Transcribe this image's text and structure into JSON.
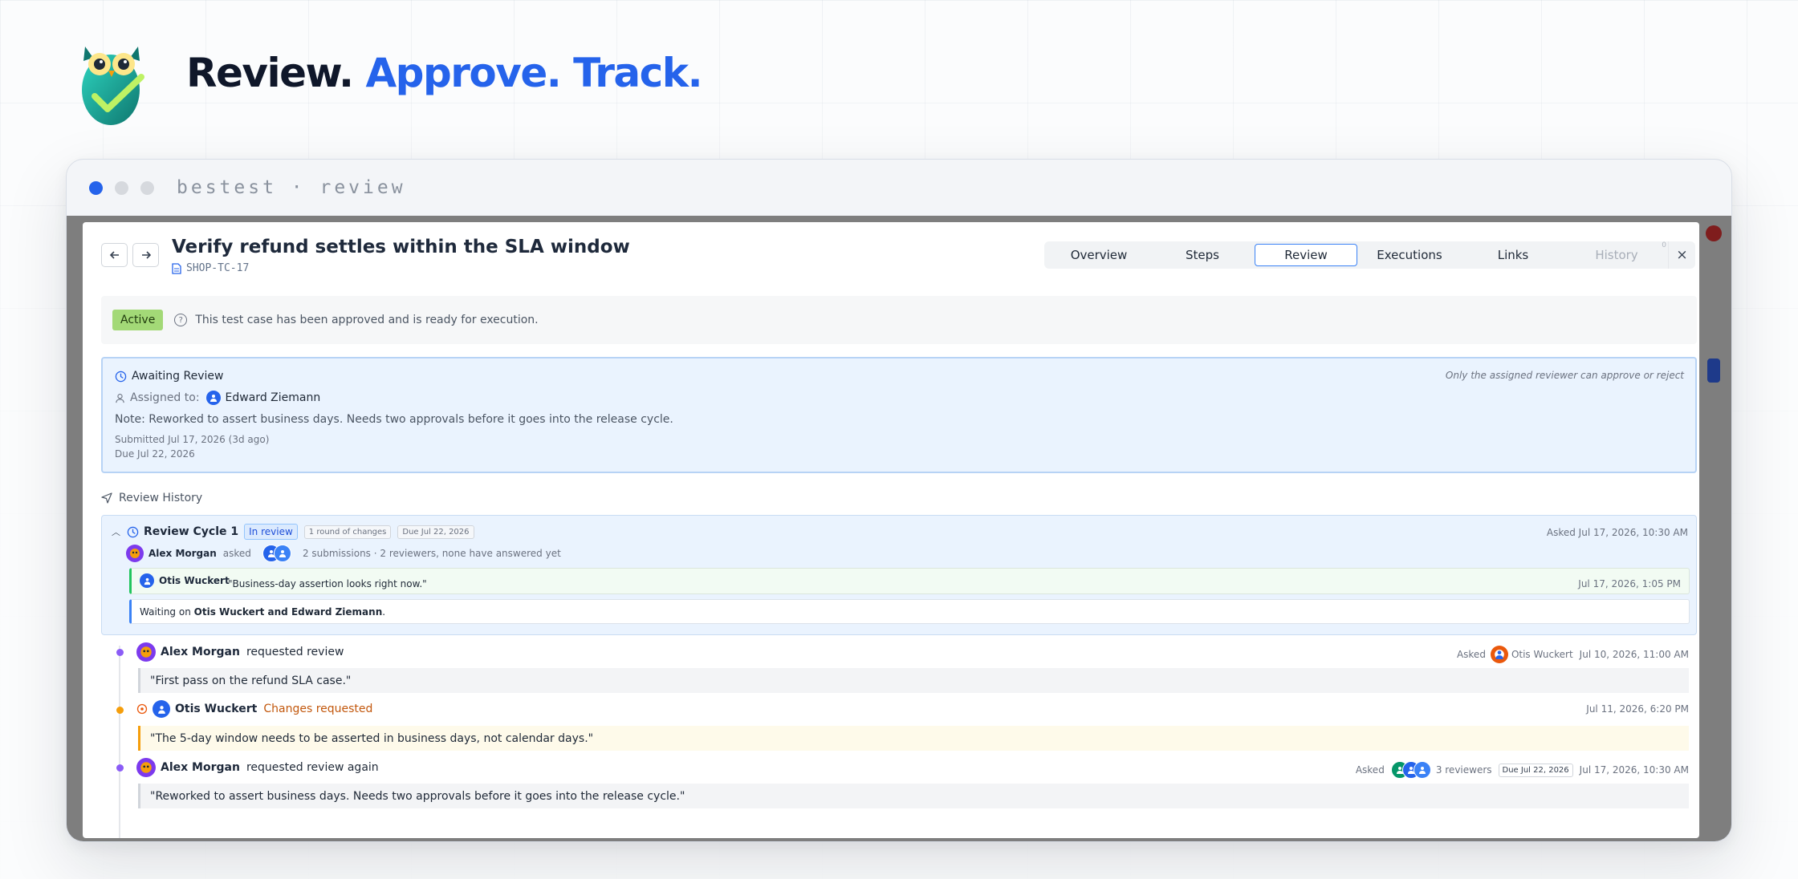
{
  "hero": {
    "title_main": "Review.",
    "title_accent": "Approve. Track."
  },
  "window": {
    "name": "bestest · review"
  },
  "test_case": {
    "title": "Verify refund settles within the SLA window",
    "id": "SHOP-TC-17"
  },
  "tabs": [
    {
      "label": "Overview",
      "active": false
    },
    {
      "label": "Steps",
      "active": false
    },
    {
      "label": "Review",
      "active": true
    },
    {
      "label": "Executions",
      "active": false
    },
    {
      "label": "Links",
      "active": false
    },
    {
      "label": "History",
      "active": false,
      "disabled": true,
      "badge": "0"
    }
  ],
  "close_icon": "×",
  "status": {
    "badge": "Active",
    "message": "This test case has been approved and is ready for execution."
  },
  "awaiting": {
    "title": "Awaiting Review",
    "assigned_label": "Assigned to:",
    "assigned_name": "Edward Ziemann",
    "note": "Note: Reworked to assert business days. Needs two approvals before it goes into the release cycle.",
    "submitted": "Submitted Jul 17, 2026 (3d ago)",
    "due": "Due Jul 22, 2026",
    "permission_note": "Only the assigned reviewer can approve or reject"
  },
  "review_history": {
    "label": "Review History",
    "cycle": {
      "title": "Review Cycle 1",
      "status": "In review",
      "rounds": "1 round of changes",
      "due": "Due Jul 22, 2026",
      "asked_at": "Asked Jul 17, 2026, 10:30 AM",
      "requester": "Alex Morgan",
      "asked_word": "asked",
      "summary": "2 submissions · 2 reviewers, none have answered yet",
      "reply": {
        "name": "Otis Wuckert",
        "quote": "\"Business-day assertion looks right now.\"",
        "time": "Jul 17, 2026, 1:05 PM"
      },
      "waiting_prefix": "Waiting on",
      "waiting_names": "Otis Wuckert and Edward Ziemann",
      "waiting_suffix": "."
    },
    "entries": [
      {
        "name": "Alex Morgan",
        "action": "requested review",
        "asked_label": "Asked",
        "asked_to": "Otis Wuckert",
        "time": "Jul 10, 2026, 11:00 AM",
        "quote": "\"First pass on the refund SLA case.\"",
        "dot_color": "#8b5cf6"
      },
      {
        "name": "Otis Wuckert",
        "action": "Changes requested",
        "time": "Jul 11, 2026, 6:20 PM",
        "quote": "\"The 5-day window needs to be asserted in business days, not calendar days.\"",
        "dot_color": "#f59e0b"
      },
      {
        "name": "Alex Morgan",
        "action": "requested review again",
        "asked_label": "Asked",
        "reviewers": "3 reviewers",
        "due": "Due Jul 22, 2026",
        "time": "Jul 17, 2026, 10:30 AM",
        "quote": "\"Reworked to assert business days. Needs two approvals before it goes into the release cycle.\"",
        "dot_color": "#8b5cf6"
      }
    ]
  },
  "colors": {
    "accent": "#2563eb",
    "active_badge": "#a3d977",
    "awaiting_bg": "#eaf3fe",
    "changes_requested": "#c2570c"
  }
}
